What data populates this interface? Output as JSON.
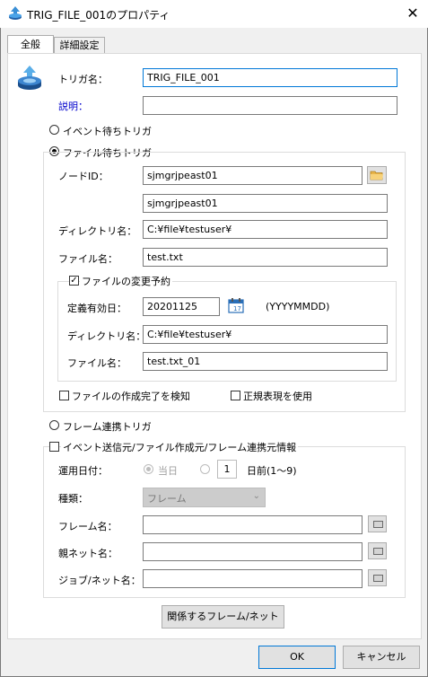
{
  "window": {
    "title": "TRIG_FILE_001のプロパティ",
    "close_glyph": "✕"
  },
  "tabs": [
    {
      "label": "全般"
    },
    {
      "label": "詳細設定"
    }
  ],
  "general": {
    "trigger_name_label": "トリガ名：",
    "trigger_name_value": "TRIG_FILE_001",
    "description_label": "説明：",
    "description_value": ""
  },
  "trigger_types": {
    "event": "イベント待ちトリガ",
    "file": "ファイル待ちトリガ",
    "frame": "フレーム連携トリガ",
    "selected": "file"
  },
  "file_trigger": {
    "node_id_label": "ノードID：",
    "node_id_value": "sjmgrjpeast01",
    "node_id_value2": "sjmgrjpeast01",
    "directory_label": "ディレクトリ名：",
    "directory_value": "C:¥file¥testuser¥",
    "filename_label": "ファイル名：",
    "filename_value": "test.txt",
    "change_reservation": {
      "label": "ファイルの変更予約",
      "checked": true,
      "effective_date_label": "定義有効日：",
      "effective_date_value": "20201125",
      "date_format": "(YYYYMMDD)",
      "directory_label": "ディレクトリ名：",
      "directory_value": "C:¥file¥testuser¥",
      "filename_label": "ファイル名：",
      "filename_value": "test.txt_01"
    },
    "detect_creation_label": "ファイルの作成完了を検知",
    "detect_creation_checked": false,
    "use_regex_label": "正規表現を使用",
    "use_regex_checked": false
  },
  "source_info": {
    "label": "イベント送信元/ファイル作成元/フレーム連携元情報",
    "checked": false,
    "operation_date_label": "運用日付：",
    "today_label": "当日",
    "days_before_value": "1",
    "days_before_label": "日前(1〜9)",
    "kind_label": "種類：",
    "kind_value": "フレーム",
    "frame_name_label": "フレーム名：",
    "frame_name_value": "",
    "parent_net_label": "親ネット名：",
    "parent_net_value": "",
    "job_net_label": "ジョブ/ネット名：",
    "job_net_value": ""
  },
  "buttons": {
    "related_frame_net": "関係するフレーム/ネット",
    "ok": "OK",
    "cancel": "キャンセル"
  },
  "colors": {
    "accent": "#0078d7",
    "link_label": "#0000cc"
  }
}
